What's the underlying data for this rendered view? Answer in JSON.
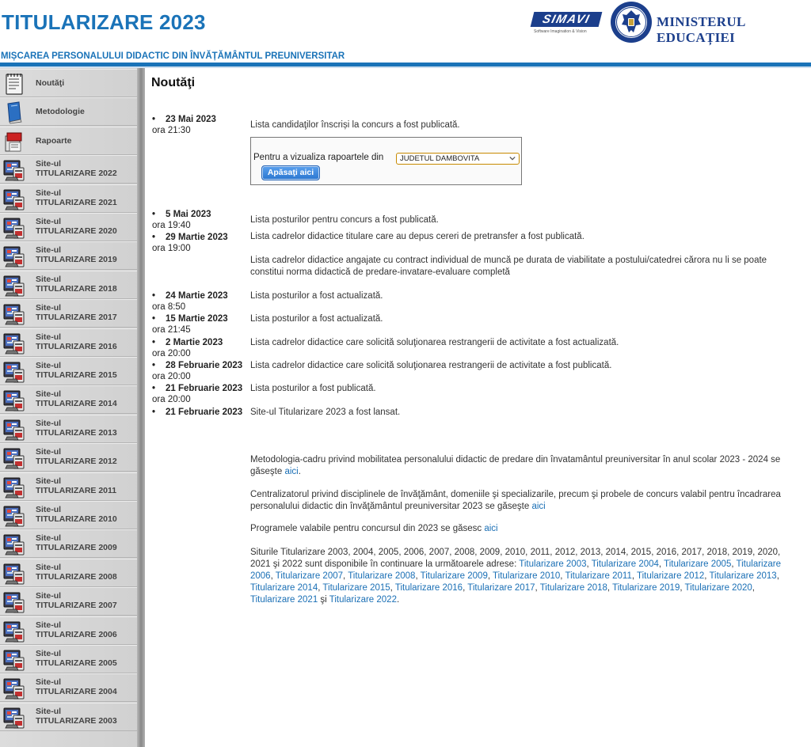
{
  "header": {
    "title": "TITULARIZARE 2023",
    "subtitle": "MIȘCAREA PERSONALULUI DIDACTIC DIN ÎNVĂȚĂMÂNTUL PREUNIVERSITAR",
    "simavi_logo": "SIMAVI",
    "simavi_tagline": "Software Imagination & Vision",
    "ministry_logo": "MINISTERUL EDUCAȚIEI",
    "colors": {
      "brand_blue": "#1a73b8",
      "logo_navy": "#1c3f8c"
    }
  },
  "sidebar": {
    "items": [
      {
        "label1": "Noutăţi",
        "label2": "",
        "icon": "notepad-icon"
      },
      {
        "label1": "Metodologie",
        "label2": "",
        "icon": "book-icon"
      },
      {
        "label1": "Rapoarte",
        "label2": "",
        "icon": "report-icon"
      },
      {
        "label1": "Site-ul",
        "label2": "TITULARIZARE 2022",
        "icon": "monitor-icon"
      },
      {
        "label1": "Site-ul",
        "label2": "TITULARIZARE 2021",
        "icon": "monitor-icon"
      },
      {
        "label1": "Site-ul",
        "label2": "TITULARIZARE 2020",
        "icon": "monitor-icon"
      },
      {
        "label1": "Site-ul",
        "label2": "TITULARIZARE 2019",
        "icon": "monitor-icon"
      },
      {
        "label1": "Site-ul",
        "label2": "TITULARIZARE 2018",
        "icon": "monitor-icon"
      },
      {
        "label1": "Site-ul",
        "label2": "TITULARIZARE 2017",
        "icon": "monitor-icon"
      },
      {
        "label1": "Site-ul",
        "label2": "TITULARIZARE 2016",
        "icon": "monitor-icon"
      },
      {
        "label1": "Site-ul",
        "label2": "TITULARIZARE 2015",
        "icon": "monitor-icon"
      },
      {
        "label1": "Site-ul",
        "label2": "TITULARIZARE 2014",
        "icon": "monitor-icon"
      },
      {
        "label1": "Site-ul",
        "label2": "TITULARIZARE 2013",
        "icon": "monitor-icon"
      },
      {
        "label1": "Site-ul",
        "label2": "TITULARIZARE 2012",
        "icon": "monitor-icon"
      },
      {
        "label1": "Site-ul",
        "label2": "TITULARIZARE 2011",
        "icon": "monitor-icon"
      },
      {
        "label1": "Site-ul",
        "label2": "TITULARIZARE 2010",
        "icon": "monitor-icon"
      },
      {
        "label1": "Site-ul",
        "label2": "TITULARIZARE 2009",
        "icon": "monitor-icon"
      },
      {
        "label1": "Site-ul",
        "label2": "TITULARIZARE 2008",
        "icon": "monitor-icon"
      },
      {
        "label1": "Site-ul",
        "label2": "TITULARIZARE 2007",
        "icon": "monitor-icon"
      },
      {
        "label1": "Site-ul",
        "label2": "TITULARIZARE 2006",
        "icon": "monitor-icon"
      },
      {
        "label1": "Site-ul",
        "label2": "TITULARIZARE 2005",
        "icon": "monitor-icon"
      },
      {
        "label1": "Site-ul",
        "label2": "TITULARIZARE 2004",
        "icon": "monitor-icon"
      },
      {
        "label1": "Site-ul",
        "label2": "TITULARIZARE 2003",
        "icon": "monitor-icon"
      }
    ]
  },
  "main": {
    "heading": "Noutăţi",
    "news": [
      {
        "date": "23 Mai 2023",
        "time": "ora 21:30",
        "text": "Lista candidaţilor înscriși la concurs a fost publicată."
      },
      {
        "date": "5 Mai 2023",
        "time": "ora 19:40",
        "text": "Lista posturilor pentru concurs a fost publicată."
      },
      {
        "date": "29 Martie 2023",
        "time": "ora 19:00",
        "text": "Lista cadrelor didactice titulare care au depus cereri de pretransfer a fost publicată.",
        "text2": "Lista cadrelor didactice angajate cu contract individual de muncă pe durata de viabilitate a postului/catedrei cărora nu li se poate constitui norma didactică de predare-invatare-evaluare completă"
      },
      {
        "date": "24 Martie 2023",
        "time": "ora 8:50",
        "text": "Lista posturilor a fost actualizată."
      },
      {
        "date": "15 Martie 2023",
        "time": "ora 21:45",
        "text": "Lista posturilor a fost actualizată."
      },
      {
        "date": "2 Martie 2023",
        "time": "ora 20:00",
        "text": "Lista cadrelor didactice care solicită soluţionarea restrangerii de activitate a fost actualizată."
      },
      {
        "date": "28 Februarie 2023",
        "time": "ora 20:00",
        "text": "Lista cadrelor didactice care solicită soluţionarea restrangerii de activitate a fost publicată."
      },
      {
        "date": "21 Februarie 2023",
        "time": "ora 20:00",
        "text": "Lista posturilor a fost publicată."
      },
      {
        "date": "21 Februarie 2023",
        "time": "",
        "text": "Site-ul Titularizare 2023 a fost lansat."
      }
    ],
    "report": {
      "label": "Pentru a vizualiza rapoartele din",
      "selected_county": "JUDETUL DAMBOVITA",
      "button": "Apăsaţi aici"
    },
    "methodology": {
      "text": "Metodologia-cadru privind mobilitatea personalului didactic de predare din învatamântul preuniversitar în anul scolar 2023 - 2024 se găseşte ",
      "link": "aici",
      "end": "."
    },
    "centralizator": {
      "text": "Centralizatorul privind disciplinele de învăţământ, domeniile şi specializarile, precum şi probele de concurs valabil pentru încadrarea personalului didactic din învăţământul preuniversitar 2023 se găseşte ",
      "link": "aici"
    },
    "programe": {
      "text": "Programele valabile pentru concursul din 2023 se găsesc ",
      "link": "aici"
    },
    "sites": {
      "intro": "Siturile Titularizare 2003, 2004, 2005, 2006, 2007, 2008, 2009, 2010, 2011, 2012, 2013, 2014, 2015, 2016, 2017, 2018, 2019, 2020, 2021 şi 2022 sunt disponibile în continuare la următoarele adrese: ",
      "links": [
        "Titularizare 2003",
        "Titularizare 2004",
        "Titularizare 2005",
        "Titularizare 2006",
        "Titularizare 2007",
        "Titularizare 2008",
        "Titularizare 2009",
        "Titularizare 2010",
        "Titularizare 2011",
        "Titularizare 2012",
        "Titularizare 2013",
        "Titularizare 2014",
        "Titularizare 2015",
        "Titularizare 2016",
        "Titularizare 2017",
        "Titularizare 2018",
        "Titularizare 2019",
        "Titularizare 2020",
        "Titularizare 2021",
        "Titularizare 2022"
      ],
      "sep": ", ",
      "and": " şi ",
      "end": "."
    }
  }
}
